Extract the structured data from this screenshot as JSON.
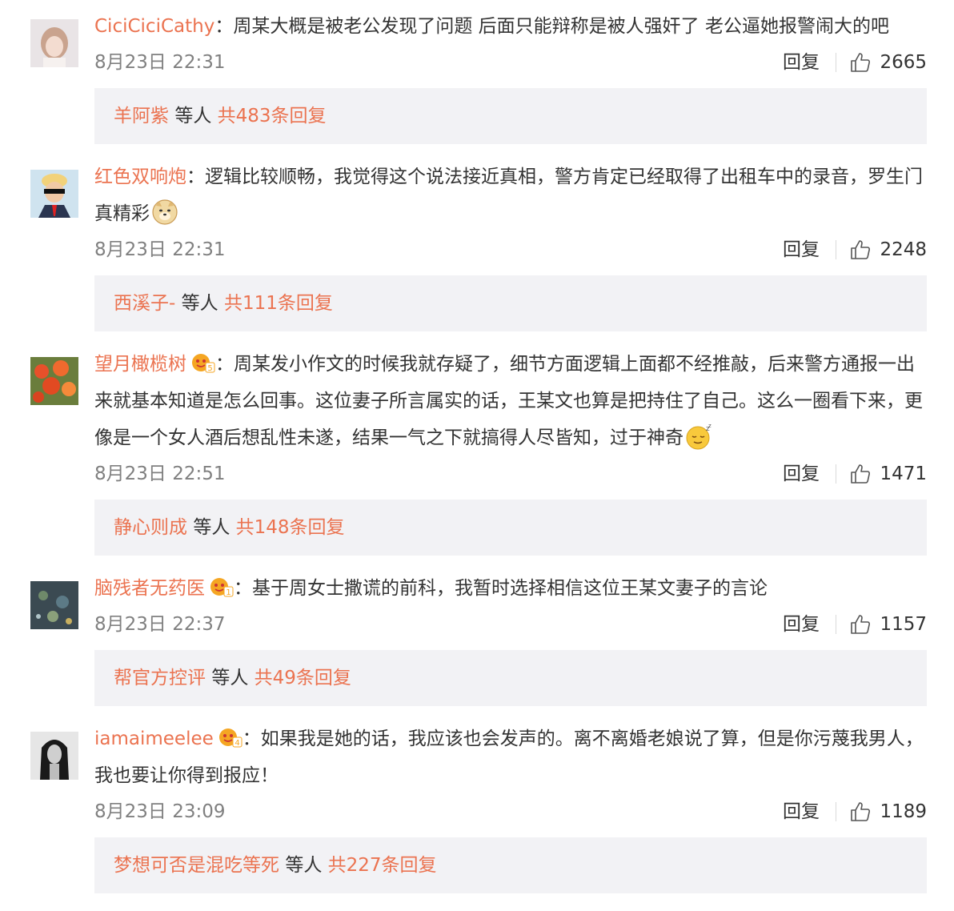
{
  "comments": [
    {
      "user": "CiciCiciCathy",
      "content": "周某大概是被老公发现了问题 后面只能辩称是被人强奸了 老公逼她报警闹大的吧",
      "time": "8月23日 22:31",
      "reply_label": "回复",
      "likes": "2665",
      "sub": {
        "user": "羊阿紫",
        "middle": "等人",
        "total": "共483条回复"
      }
    },
    {
      "user": "红色双响炮",
      "content": "逻辑比较顺畅，我觉得这个说法接近真相，警方肯定已经取得了出租车中的录音，罗生门真精彩",
      "time": "8月23日 22:31",
      "reply_label": "回复",
      "likes": "2248",
      "sub": {
        "user": "西溪子-",
        "middle": "等人",
        "total": "共111条回复"
      }
    },
    {
      "user": "望月橄榄树",
      "badge": "5",
      "content": "周某发小作文的时候我就存疑了，细节方面逻辑上面都不经推敲，后来警方通报一出来就基本知道是怎么回事。这位妻子所言属实的话，王某文也算是把持住了自己。这么一圈看下来，更像是一个女人酒后想乱性未遂，结果一气之下就搞得人尽皆知，过于神奇",
      "time": "8月23日 22:51",
      "reply_label": "回复",
      "likes": "1471",
      "sub": {
        "user": "静心则成",
        "middle": "等人",
        "total": "共148条回复"
      }
    },
    {
      "user": "脑残者无药医",
      "badge": "1",
      "content": "基于周女士撒谎的前科，我暂时选择相信这位王某文妻子的言论",
      "time": "8月23日 22:37",
      "reply_label": "回复",
      "likes": "1157",
      "sub": {
        "user": "帮官方控评",
        "middle": "等人",
        "total": "共49条回复"
      }
    },
    {
      "user": "iamaimeelee",
      "badge": "4",
      "content": "如果我是她的话，我应该也会发声的。离不离婚老娘说了算，但是你污蔑我男人，我也要让你得到报应！",
      "time": "8月23日 23:09",
      "reply_label": "回复",
      "likes": "1189",
      "sub": {
        "user": "梦想可否是混吃等死",
        "middle": "等人",
        "total": "共227条回复"
      }
    }
  ],
  "icons": {
    "like": "thumbs-up-icon",
    "doge": "doge-emoji",
    "sleepy": "sleepy-emoji",
    "vip": "vip-fan-badge-icon"
  },
  "colors": {
    "username": "#eb7350",
    "time": "#808080",
    "subreply_bg": "#f2f2f5"
  }
}
